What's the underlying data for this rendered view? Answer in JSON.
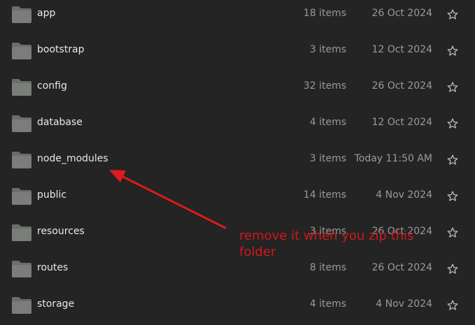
{
  "files": [
    {
      "name": "app",
      "count": "18 items",
      "date": "26 Oct 2024"
    },
    {
      "name": "bootstrap",
      "count": "3 items",
      "date": "12 Oct 2024"
    },
    {
      "name": "config",
      "count": "32 items",
      "date": "26 Oct 2024"
    },
    {
      "name": "database",
      "count": "4 items",
      "date": "12 Oct 2024"
    },
    {
      "name": "node_modules",
      "count": "3 items",
      "date": "Today 11:50 AM"
    },
    {
      "name": "public",
      "count": "14 items",
      "date": "4 Nov 2024"
    },
    {
      "name": "resources",
      "count": "3 items",
      "date": "26 Oct 2024"
    },
    {
      "name": "routes",
      "count": "8 items",
      "date": "26 Oct 2024"
    },
    {
      "name": "storage",
      "count": "4 items",
      "date": "4 Nov 2024"
    }
  ],
  "annotation": {
    "text": "remove it when you zip this folder",
    "color": "#d01818"
  },
  "icons": {
    "folder": "folder-icon",
    "star": "star-icon"
  },
  "colors": {
    "background": "#242424",
    "folder": "#7a7d79",
    "folder_tab": "#6a6d69"
  }
}
